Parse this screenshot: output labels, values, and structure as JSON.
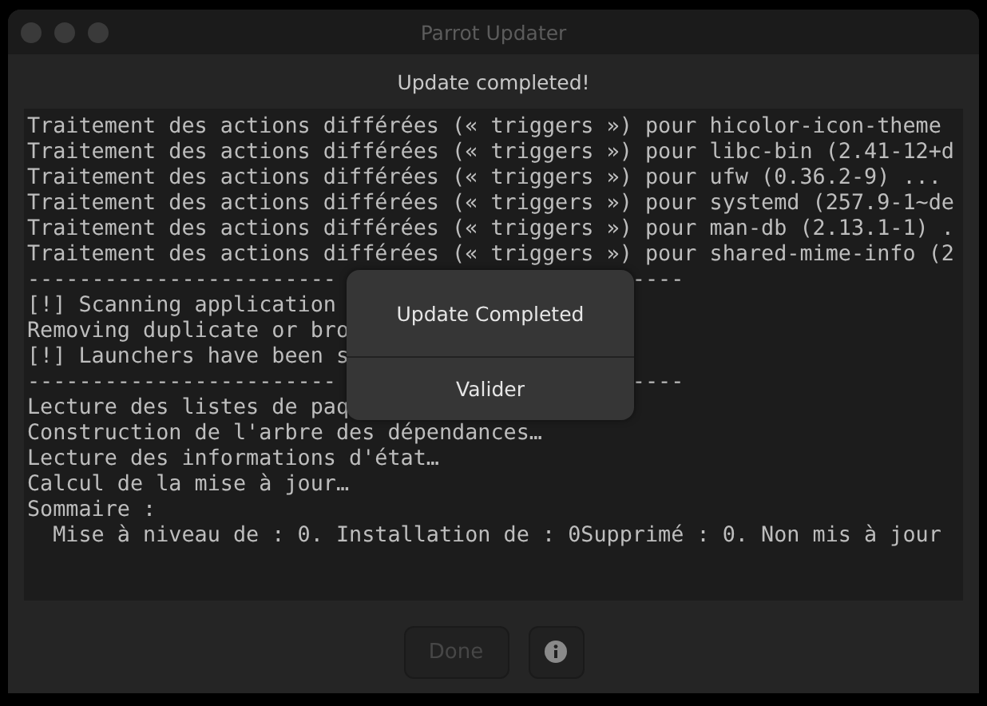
{
  "window": {
    "title": "Parrot Updater"
  },
  "header": "Update completed!",
  "log": [
    {
      "text": "Traitement des actions différées (« triggers ») pour hicolor-icon-theme"
    },
    {
      "text": "Traitement des actions différées (« triggers ») pour libc-bin (2.41-12+d"
    },
    {
      "text": "Traitement des actions différées (« triggers ») pour ufw (0.36.2-9) ..."
    },
    {
      "text": "Traitement des actions différées (« triggers ») pour systemd (257.9-1~de"
    },
    {
      "text": "Traitement des actions différées (« triggers ») pour man-db (2.13.1-1) ."
    },
    {
      "text": "Traitement des actions différées (« triggers ») pour shared-mime-info (2"
    },
    {
      "text": "------------------------",
      "tail": "----"
    },
    {
      "text": "[!] Scanning application"
    },
    {
      "text": "Removing duplicate or bro"
    },
    {
      "text": "[!] Launchers have been s"
    },
    {
      "text": "------------------------",
      "tail": "----"
    },
    {
      "text": "Lecture des listes de paq"
    },
    {
      "text": "Construction de l'arbre des dépendances…"
    },
    {
      "text": "Lecture des informations d'état…"
    },
    {
      "text": "Calcul de la mise à jour…"
    },
    {
      "text": "Sommaire :"
    },
    {
      "text": "  Mise à niveau de : 0. Installation de : 0Supprimé : 0. Non mis à jour"
    }
  ],
  "dialog": {
    "message": "Update Completed",
    "button": "Valider"
  },
  "buttons": [
    {
      "kind": "text",
      "label": "Done",
      "disabled": true
    },
    {
      "kind": "info",
      "disabled": false
    }
  ]
}
